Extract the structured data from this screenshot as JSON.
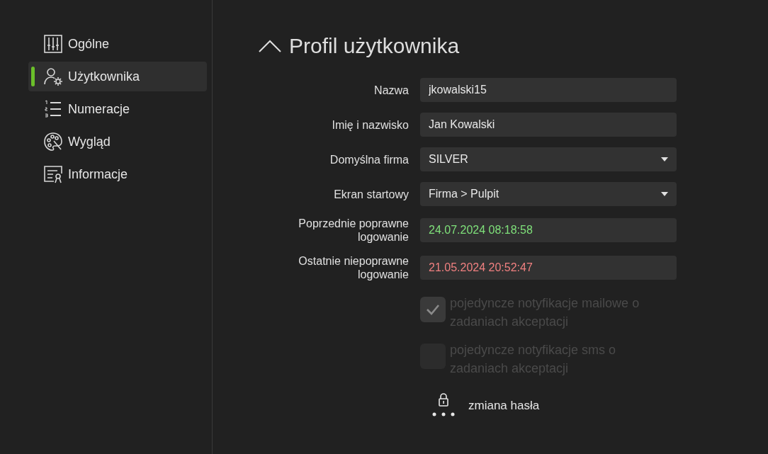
{
  "sidebar": {
    "items": [
      {
        "label": "Ogólne",
        "selected": false
      },
      {
        "label": "Użytkownika",
        "selected": true
      },
      {
        "label": "Numeracje",
        "selected": false
      },
      {
        "label": "Wygląd",
        "selected": false
      },
      {
        "label": "Informacje",
        "selected": false
      }
    ]
  },
  "section": {
    "title": "Profil użytkownika",
    "expanded": true
  },
  "fields": [
    {
      "label": "Nazwa",
      "kind": "text",
      "value": "jkowalski15"
    },
    {
      "label": "Imię i nazwisko",
      "kind": "text",
      "value": "Jan Kowalski"
    },
    {
      "label": "Domyślna firma",
      "kind": "select",
      "value": "SILVER"
    },
    {
      "label": "Ekran startowy",
      "kind": "select",
      "value": "Firma > Pulpit"
    },
    {
      "label": "Poprzednie poprawne logowanie",
      "kind": "status",
      "value": "24.07.2024 08:18:58",
      "color": "#7fe07a"
    },
    {
      "label": "Ostatnie niepoprawne logowanie",
      "kind": "status",
      "value": "21.05.2024 20:52:47",
      "color": "#f08080"
    }
  ],
  "checkboxes": [
    {
      "label": "pojedyncze notyfikacje mailowe o zadaniach akceptacji",
      "checked": true,
      "disabled": true
    },
    {
      "label": "pojedyncze notyfikacje sms o zadaniach akceptacji",
      "checked": false,
      "disabled": true
    }
  ],
  "password_button": {
    "label": "zmiana hasła"
  }
}
